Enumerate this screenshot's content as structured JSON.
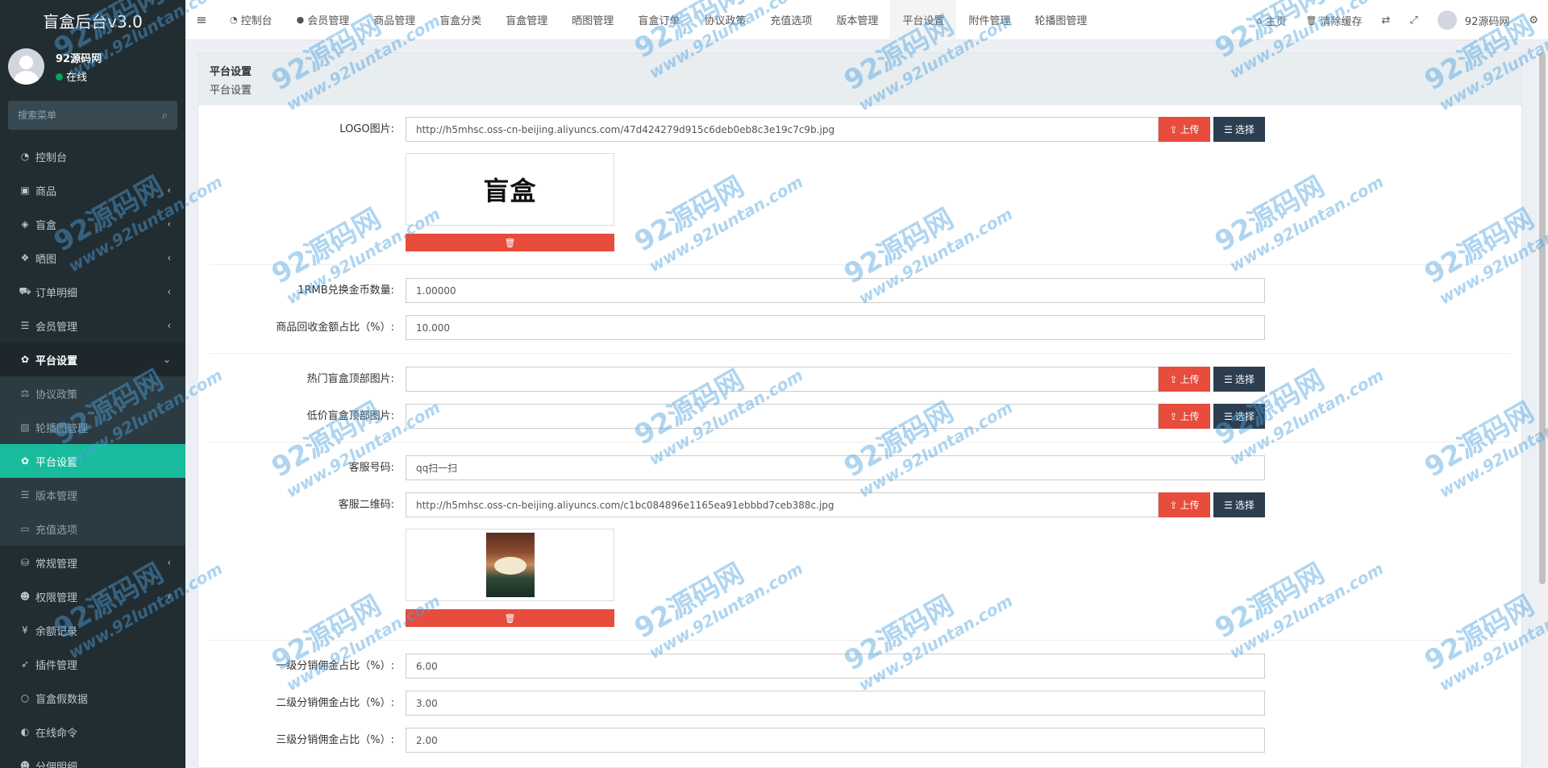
{
  "sidebar": {
    "logo": "盲盒后台v3.0",
    "user_name": "92源码网",
    "user_status": "在线",
    "search_placeholder": "搜索菜单",
    "items": [
      {
        "label": "控制台",
        "icon": "dashboard-icon",
        "chev": ""
      },
      {
        "label": "商品",
        "icon": "bag-icon",
        "chev": "‹"
      },
      {
        "label": "盲盒",
        "icon": "cube-icon",
        "chev": "‹"
      },
      {
        "label": "晒图",
        "icon": "dropbox-icon",
        "chev": "‹"
      },
      {
        "label": "订单明细",
        "icon": "cart-icon",
        "chev": "‹"
      },
      {
        "label": "会员管理",
        "icon": "list-icon",
        "chev": "‹"
      },
      {
        "label": "平台设置",
        "icon": "gear-icon",
        "chev": "⌄"
      },
      {
        "label": "协议政策",
        "icon": "balance-icon",
        "chev": ""
      },
      {
        "label": "轮播图管理",
        "icon": "image-icon",
        "chev": ""
      },
      {
        "label": "平台设置",
        "icon": "gear-icon",
        "chev": ""
      },
      {
        "label": "版本管理",
        "icon": "list-icon",
        "chev": ""
      },
      {
        "label": "充值选项",
        "icon": "card-icon",
        "chev": ""
      },
      {
        "label": "常规管理",
        "icon": "database-icon",
        "chev": "‹"
      },
      {
        "label": "权限管理",
        "icon": "users-icon",
        "chev": "‹"
      },
      {
        "label": "余额记录",
        "icon": "yen-icon",
        "chev": ""
      },
      {
        "label": "插件管理",
        "icon": "rocket-icon",
        "chev": ""
      },
      {
        "label": "盲盒假数据",
        "icon": "circle-icon",
        "chev": ""
      },
      {
        "label": "在线命令",
        "icon": "half-circle-icon",
        "chev": ""
      },
      {
        "label": "分佣明细",
        "icon": "users-icon",
        "chev": ""
      }
    ]
  },
  "topbar": {
    "tabs": [
      {
        "label": "控制台",
        "icon": "dashboard-icon",
        "glyph": "◔"
      },
      {
        "label": "会员管理",
        "icon": "user-icon",
        "glyph": "●"
      },
      {
        "label": "商品管理",
        "icon": "",
        "glyph": ""
      },
      {
        "label": "盲盒分类",
        "icon": "",
        "glyph": ""
      },
      {
        "label": "盲盒管理",
        "icon": "",
        "glyph": ""
      },
      {
        "label": "晒图管理",
        "icon": "",
        "glyph": ""
      },
      {
        "label": "盲盒订单",
        "icon": "",
        "glyph": ""
      },
      {
        "label": "协议政策",
        "icon": "",
        "glyph": ""
      },
      {
        "label": "充值选项",
        "icon": "",
        "glyph": ""
      },
      {
        "label": "版本管理",
        "icon": "",
        "glyph": ""
      },
      {
        "label": "平台设置",
        "icon": "",
        "glyph": ""
      },
      {
        "label": "附件管理",
        "icon": "",
        "glyph": ""
      },
      {
        "label": "轮播图管理",
        "icon": "",
        "glyph": ""
      }
    ],
    "home": "主页",
    "clear_cache": "清除缓存",
    "user": "92源码网"
  },
  "panel": {
    "title": "平台设置",
    "subtitle": "平台设置"
  },
  "form": {
    "upload_label": "上传",
    "select_label": "选择",
    "logo_label": "LOGO图片:",
    "logo_value": "http://h5mhsc.oss-cn-beijing.aliyuncs.com/47d424279d915c6deb0eb8c3e19c7c9b.jpg",
    "logo_preview_text": "盲盒",
    "rmb_label": "1RMB兑换金币数量:",
    "rmb_value": "1.00000",
    "recycle_label": "商品回收金额占比（%）:",
    "recycle_value": "10.000",
    "hot_label": "热门盲盒顶部图片:",
    "hot_value": "",
    "low_label": "低价盲盒顶部图片:",
    "low_value": "",
    "service_no_label": "客服号码:",
    "service_no_value": "qq扫一扫",
    "qr_label": "客服二维码:",
    "qr_value": "http://h5mhsc.oss-cn-beijing.aliyuncs.com/c1bc084896e1165ea91ebbbd7ceb388c.jpg",
    "level1_label": "一级分销佣金占比（%）:",
    "level1_value": "6.00",
    "level2_label": "二级分销佣金占比（%）:",
    "level2_value": "3.00",
    "level3_label": "三级分销佣金占比（%）:",
    "level3_value": "2.00"
  },
  "watermark": {
    "line1": "92源码网",
    "line2": "www.92luntan.com"
  }
}
